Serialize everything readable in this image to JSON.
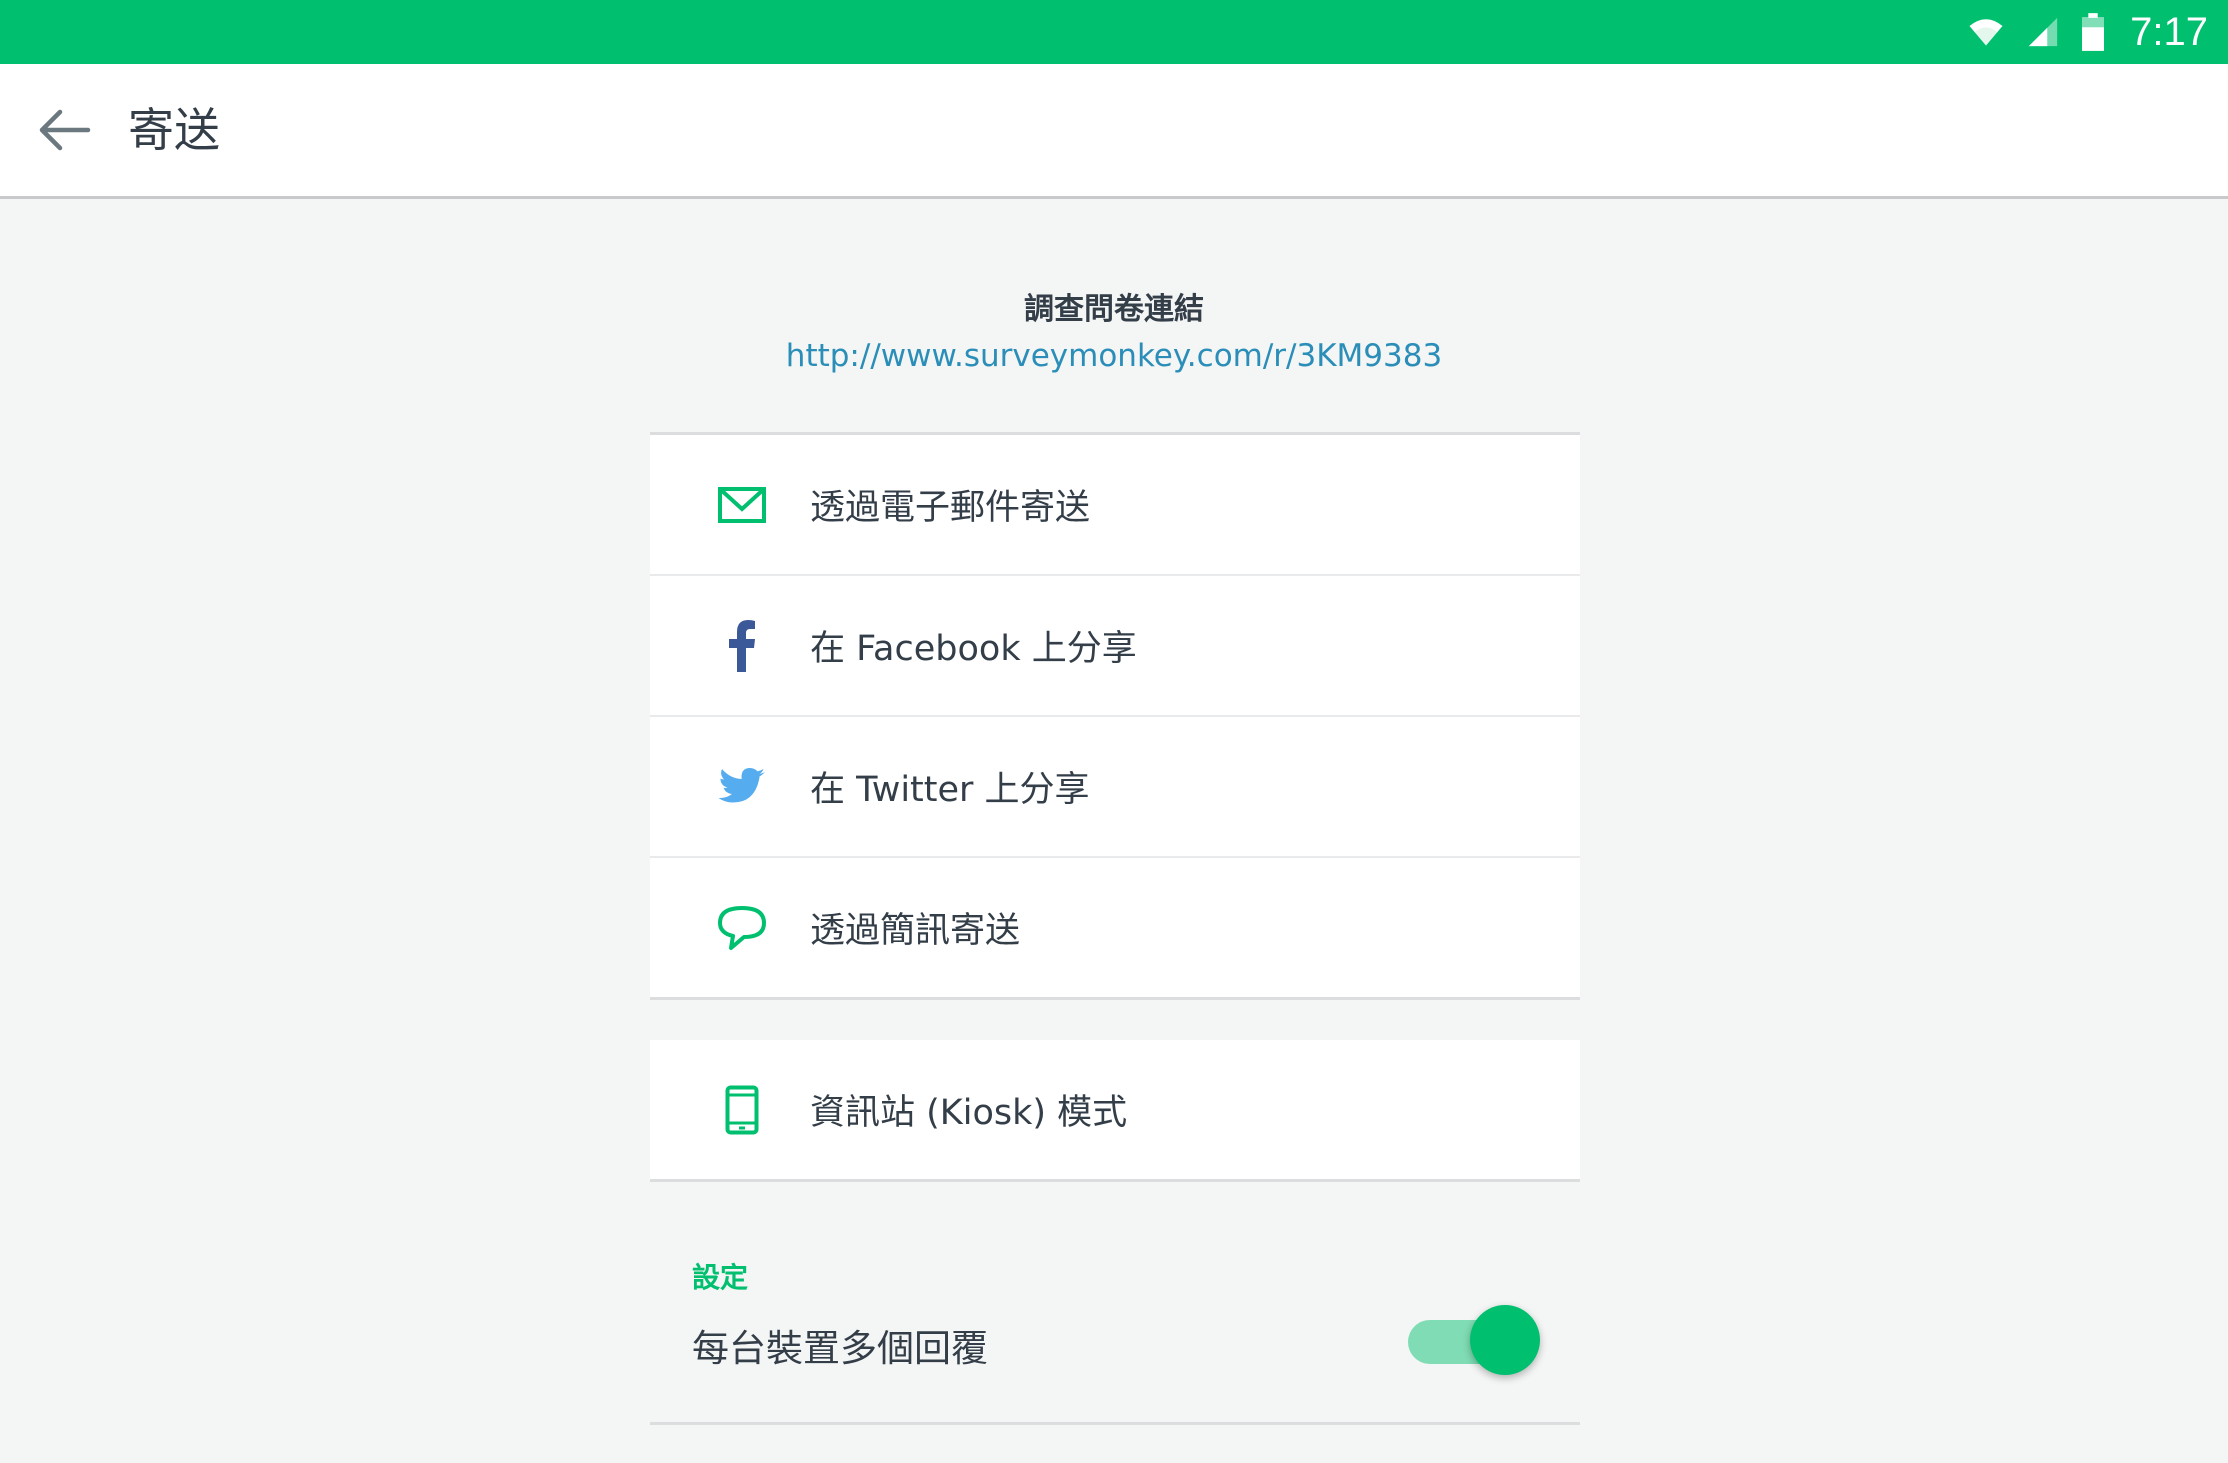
{
  "status_bar": {
    "time": "7:17",
    "icons": [
      "wifi-icon",
      "cell-signal-icon",
      "battery-icon"
    ],
    "color": "#00bf6f"
  },
  "app_bar": {
    "back_icon": "arrow-left-icon",
    "title": "寄送"
  },
  "survey_link": {
    "label": "調查問卷連結",
    "url": "http://www.surveymonkey.com/r/3KM9383"
  },
  "share_options": [
    {
      "icon": "envelope-icon",
      "label": "透過電子郵件寄送"
    },
    {
      "icon": "facebook-icon",
      "label": "在 Facebook 上分享"
    },
    {
      "icon": "twitter-icon",
      "label": "在 Twitter 上分享"
    },
    {
      "icon": "speech-bubble-icon",
      "label": "透過簡訊寄送"
    }
  ],
  "kiosk_option": {
    "icon": "phone-icon",
    "label": "資訊站 (Kiosk) 模式"
  },
  "settings": {
    "heading": "設定",
    "multiple_responses": {
      "label": "每台裝置多個回覆",
      "enabled": true
    }
  },
  "colors": {
    "accent": "#00bf6f",
    "link": "#2a8eb8",
    "facebook": "#3b5998",
    "twitter": "#55acee"
  }
}
